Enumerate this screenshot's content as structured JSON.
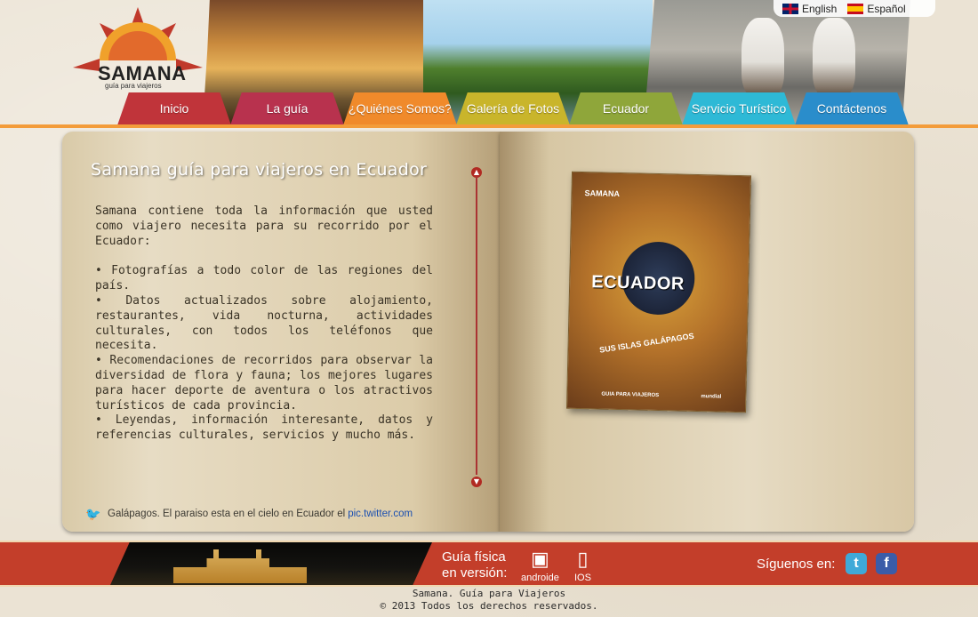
{
  "header": {
    "logo_brand": "SAMANA",
    "logo_tagline": "guía para viajeros",
    "languages": [
      {
        "label": "English",
        "flag_icon": "uk-flag-icon"
      },
      {
        "label": "Español",
        "flag_icon": "spain-flag-icon"
      }
    ]
  },
  "nav": {
    "items": [
      {
        "label": "Inicio",
        "color": "#c0343a"
      },
      {
        "label": "La guía",
        "color": "#b8324e"
      },
      {
        "label": "¿Quiénes Somos?",
        "color": "#f08a2b"
      },
      {
        "label": "Galería de Fotos",
        "color": "#c9b52b"
      },
      {
        "label": "Ecuador",
        "color": "#8fa63a"
      },
      {
        "label": "Servicio Turístico",
        "color": "#2eb9d6"
      },
      {
        "label": "Contáctenos",
        "color": "#2a8dcb"
      }
    ]
  },
  "main": {
    "title": "Samana guía para viajeros en Ecuador",
    "intro": "Samana contiene toda la información que usted como viajero necesita para su recorrido por el Ecuador:",
    "bullets": [
      "• Fotografías a todo color de las regiones del país.",
      "• Datos actualizados sobre alojamiento, restaurantes, vida nocturna, actividades culturales, con todos los teléfonos que necesita.",
      "• Recomendaciones de recorridos para observar la diversidad de flora y fauna; los mejores lugares para hacer deporte de aventura o los atractivos turísticos de cada provincia.",
      "• Leyendas, información interesante, datos y referencias culturales, servicios y mucho más."
    ],
    "tweet_text": "Galápagos. El paraiso esta en el cielo en Ecuador el",
    "tweet_link": "pic.twitter.com"
  },
  "book_cover": {
    "label": "SAMANA",
    "name": "ECUADOR",
    "subtitle": "SUS ISLAS GALÁPAGOS",
    "band": "GUIA PARA VIAJEROS",
    "publisher": "mundial"
  },
  "footer": {
    "guide_line1": "Guía física",
    "guide_line2": "en versión:",
    "apps": [
      {
        "label": "androide",
        "icon": "android-icon"
      },
      {
        "label": "IOS",
        "icon": "phone-icon"
      }
    ],
    "follow_label": "Síguenos en:",
    "social": [
      {
        "name": "twitter-icon",
        "color": "#3fa9d8"
      },
      {
        "name": "facebook-icon",
        "color": "#3b5ca8"
      }
    ],
    "copyright_line1": "Samana. Guía para Viajeros",
    "copyright_line2": "© 2013 Todos los derechos reservados."
  },
  "colors": {
    "accent_orange": "#f39c3a",
    "footer_red": "#c33e2a"
  }
}
